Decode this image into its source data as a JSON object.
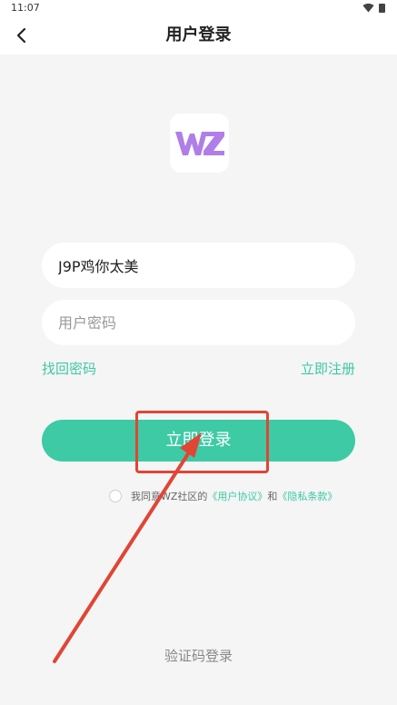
{
  "status_bar": {
    "time": "11:07"
  },
  "header": {
    "title": "用户登录",
    "back_icon": "chevron-left-icon"
  },
  "logo": {
    "text": "WZ",
    "color": "#b07ee8"
  },
  "form": {
    "username_value": "J9P鸡你太美",
    "password_placeholder": "用户密码"
  },
  "links": {
    "forgot_password": "找回密码",
    "register": "立即注册"
  },
  "login_button": {
    "label": "立即登录",
    "color": "#3dcaa5"
  },
  "agreement": {
    "prefix": "我同意WZ社区的",
    "user_agreement": "《用户协议》",
    "conjunction": "和",
    "privacy_policy": "《隐私条款》"
  },
  "alt_login": {
    "label": "验证码登录"
  },
  "annotation_color": "#e04535",
  "accent_color": "#3dc8a4"
}
